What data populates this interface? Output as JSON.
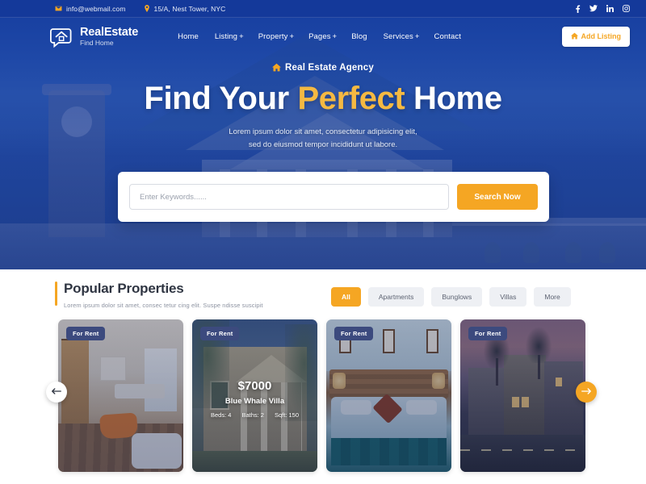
{
  "topbar": {
    "email": "info@webmail.com",
    "address": "15/A, Nest Tower, NYC",
    "email_icon": "envelope-icon",
    "address_icon": "map-pin-icon",
    "socials": [
      {
        "name": "facebook-icon",
        "glyph": "f"
      },
      {
        "name": "twitter-icon",
        "glyph": "t"
      },
      {
        "name": "linkedin-icon",
        "glyph": "in"
      },
      {
        "name": "instagram-icon",
        "glyph": "ig"
      }
    ]
  },
  "brand": {
    "name": "RealEstate",
    "tagline": "Find Home",
    "logo_icon": "house-chat-bubble-icon"
  },
  "nav": {
    "items": [
      {
        "label": "Home",
        "caret": ""
      },
      {
        "label": "Listing",
        "caret": "+"
      },
      {
        "label": "Property",
        "caret": "+"
      },
      {
        "label": "Pages",
        "caret": "+"
      },
      {
        "label": "Blog",
        "caret": ""
      },
      {
        "label": "Services",
        "caret": "+"
      },
      {
        "label": "Contact",
        "caret": ""
      }
    ],
    "cta_label": "Add Listing",
    "cta_icon": "home-icon"
  },
  "hero": {
    "tagline": "Real Estate Agency",
    "tagline_icon": "home-icon",
    "title_part1": "Find Your ",
    "title_accent": "Perfect",
    "title_part2": " Home",
    "subtitle_line1": "Lorem ipsum dolor sit amet, consectetur adipisicing elit,",
    "subtitle_line2": "sed do eiusmod tempor incididunt ut labore."
  },
  "search": {
    "placeholder": "Enter Keywords......",
    "value": "",
    "button_label": "Search Now"
  },
  "section": {
    "title": "Popular Properties",
    "subtitle": "Lorem ipsum dolor sit amet, consec tetur cing elit. Suspe ndisse suscipit",
    "filters": [
      {
        "label": "All",
        "active": true
      },
      {
        "label": "Apartments",
        "active": false
      },
      {
        "label": "Bunglows",
        "active": false
      },
      {
        "label": "Villas",
        "active": false
      },
      {
        "label": "More",
        "active": false
      }
    ]
  },
  "properties": [
    {
      "badge": "For Rent",
      "price": "",
      "name": "",
      "beds": "",
      "baths": "",
      "sqft": "",
      "alt": "bright living room interior"
    },
    {
      "badge": "For Rent",
      "price": "$7000",
      "name": "Blue Whale Villa",
      "beds": "Beds: 4",
      "baths": "Baths: 2",
      "sqft": "Sqft: 150",
      "alt": "classical columned villa exterior"
    },
    {
      "badge": "For Rent",
      "price": "",
      "name": "",
      "beds": "",
      "baths": "",
      "sqft": "",
      "alt": "bedroom with wooden headboard"
    },
    {
      "badge": "For Rent",
      "price": "",
      "name": "",
      "beds": "",
      "baths": "",
      "sqft": "",
      "alt": "apartment complex at dusk"
    }
  ],
  "carousel": {
    "prev_icon": "arrow-left-icon",
    "next_icon": "arrow-right-icon"
  },
  "colors": {
    "brand_blue": "#14399a",
    "accent_orange": "#f5a623",
    "badge_navy": "#3c4a7e",
    "chip_grey": "#eef0f4"
  }
}
